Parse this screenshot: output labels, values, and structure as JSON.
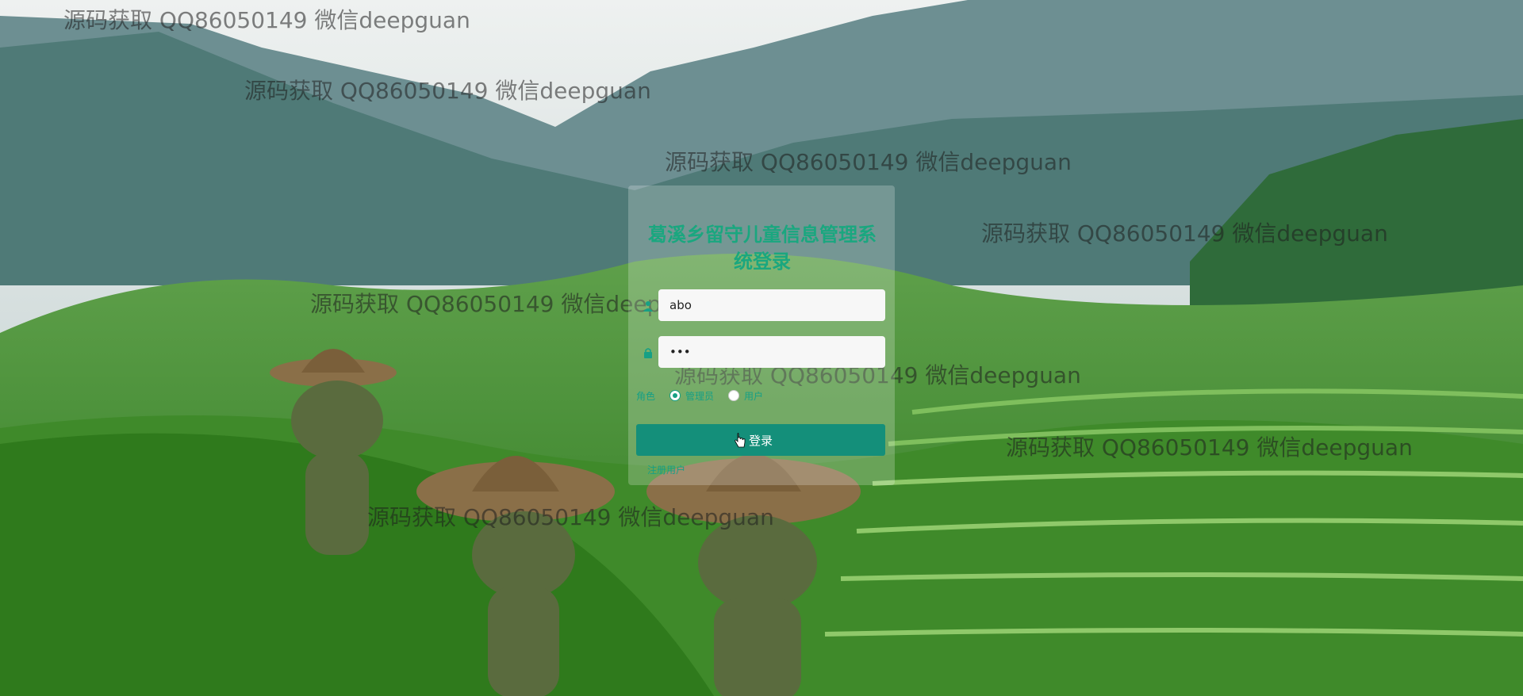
{
  "page": {
    "title": "葛溪乡留守儿童信息管理系统登录"
  },
  "form": {
    "username_value": "abo",
    "password_value": "•••",
    "role_label": "角色",
    "roles": [
      {
        "label": "管理员",
        "checked": true
      },
      {
        "label": "用户",
        "checked": false
      }
    ],
    "login_label": "登录",
    "register_label": "注册用户"
  },
  "watermark": {
    "text": "源码获取 QQ86050149 微信deepguan"
  },
  "colors": {
    "accent": "#16a085",
    "button": "#148f7a",
    "title": "#1aa77f"
  },
  "icons": {
    "user": "user-icon",
    "lock": "lock-icon",
    "cursor": "hand-cursor-icon"
  }
}
